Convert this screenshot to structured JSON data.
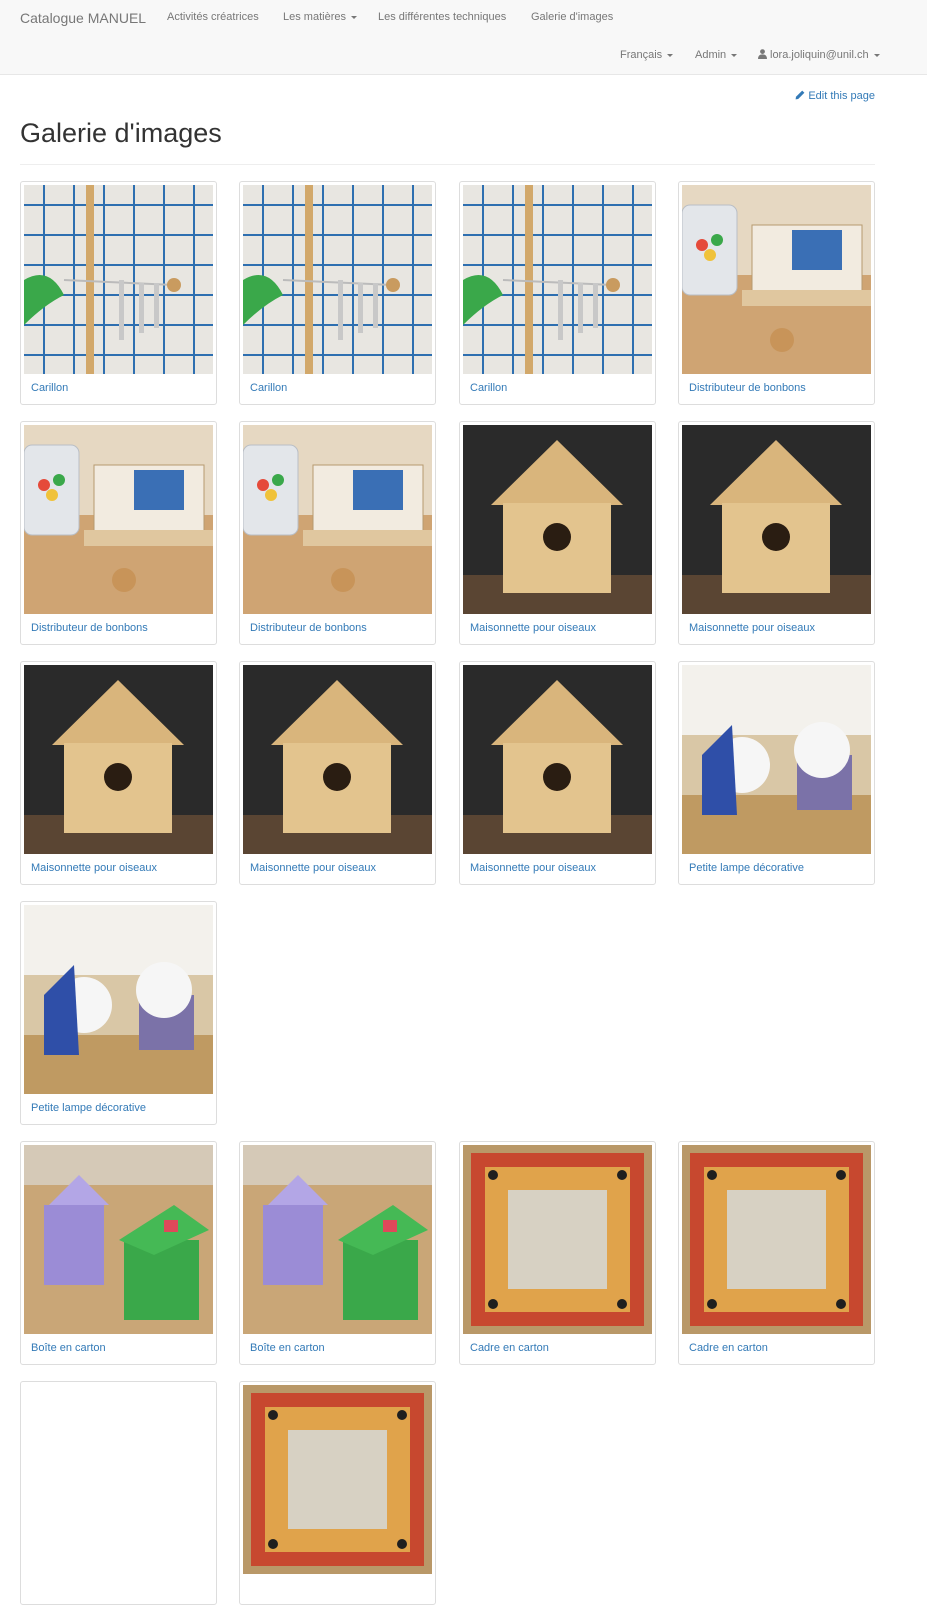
{
  "navbar": {
    "brand": "Catalogue MANUEL",
    "links": [
      {
        "label": "Activités créatrices",
        "dropdown": false
      },
      {
        "label": "Les matières",
        "dropdown": true
      },
      {
        "label": "Les différentes techniques",
        "dropdown": false
      },
      {
        "label": "Galerie d'images",
        "dropdown": false
      }
    ],
    "language": "Français",
    "admin": "Admin",
    "user": "lora.joliquin@unil.ch"
  },
  "edit_link": "Edit this page",
  "page_title": "Galerie d'images",
  "gallery": [
    {
      "caption": "Carillon",
      "photo": "wind-chime"
    },
    {
      "caption": "Carillon",
      "photo": "wind-chime"
    },
    {
      "caption": "Carillon",
      "photo": "wind-chime"
    },
    {
      "caption": "Distributeur de bonbons",
      "photo": "candy-dispenser"
    },
    {
      "caption": "Distributeur de bonbons",
      "photo": "candy-dispenser"
    },
    {
      "caption": "Distributeur de bonbons",
      "photo": "candy-dispenser"
    },
    {
      "caption": "Maisonnette pour oiseaux",
      "photo": "birdhouse"
    },
    {
      "caption": "Maisonnette pour oiseaux",
      "photo": "birdhouse"
    },
    {
      "caption": "Maisonnette pour oiseaux",
      "photo": "birdhouse"
    },
    {
      "caption": "Maisonnette pour oiseaux",
      "photo": "birdhouse"
    },
    {
      "caption": "Maisonnette pour oiseaux",
      "photo": "birdhouse"
    },
    {
      "caption": "Petite lampe décorative",
      "photo": "decorative-lamp"
    },
    {
      "caption": "Petite lampe décorative",
      "photo": "decorative-lamp"
    },
    {
      "caption": "Boîte en carton",
      "photo": "cardboard-box"
    },
    {
      "caption": "Boîte en carton",
      "photo": "cardboard-box"
    },
    {
      "caption": "Cadre en carton",
      "photo": "cardboard-frame"
    },
    {
      "caption": "Cadre en carton",
      "photo": "cardboard-frame"
    },
    {
      "caption": "",
      "photo": "blank"
    },
    {
      "caption": "",
      "photo": "cardboard-frame"
    }
  ],
  "colors": {
    "link": "#337ab7",
    "navbar_bg": "#f8f8f8",
    "navbar_text": "#777777"
  }
}
